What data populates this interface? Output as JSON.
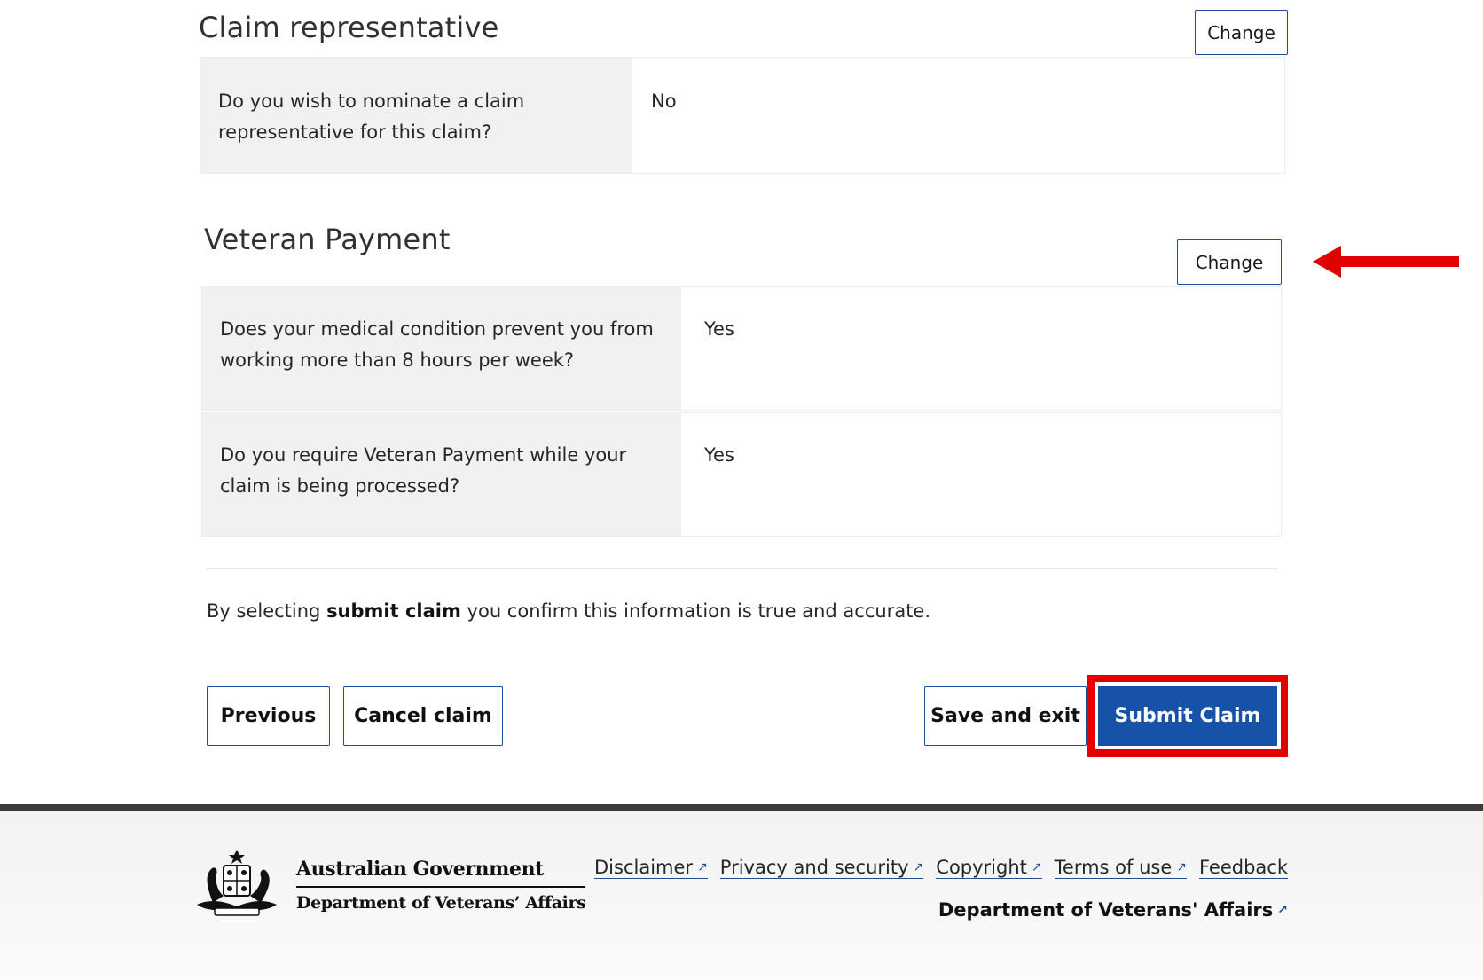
{
  "claim_rep": {
    "title": "Claim representative",
    "change_label": "Change",
    "rows": [
      {
        "question": "Do you wish to nominate a claim representative for this claim?",
        "answer": "No"
      }
    ]
  },
  "veteran_payment": {
    "title": "Veteran Payment",
    "change_label": "Change",
    "rows": [
      {
        "question": "Does your medical condition prevent you from working more than 8 hours per week?",
        "answer": "Yes"
      },
      {
        "question": "Do you require Veteran Payment while your claim is being processed?",
        "answer": "Yes"
      }
    ]
  },
  "confirm": {
    "prefix": "By selecting ",
    "bold": "submit claim",
    "suffix": " you confirm this information is true and accurate."
  },
  "actions": {
    "previous": "Previous",
    "cancel": "Cancel claim",
    "save_exit": "Save and exit",
    "submit": "Submit Claim"
  },
  "footer": {
    "logo_line1": "Australian Government",
    "logo_line2": "Department of Veterans’ Affairs",
    "links": [
      "Disclaimer",
      "Privacy and security",
      "Copyright",
      "Terms of use",
      "Feedback"
    ],
    "dva_link": "Department of Veterans' Affairs"
  },
  "colors": {
    "primary": "#1552a8",
    "highlight": "#e00000",
    "arrow": "#e00000"
  }
}
